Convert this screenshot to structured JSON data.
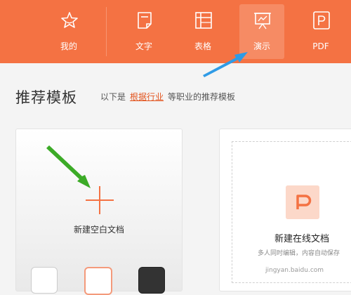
{
  "nav": {
    "items": [
      {
        "label": "我的",
        "icon": "star-icon"
      },
      {
        "label": "文字",
        "icon": "document-icon"
      },
      {
        "label": "表格",
        "icon": "table-icon"
      },
      {
        "label": "演示",
        "icon": "presentation-icon"
      },
      {
        "label": "PDF",
        "icon": "pdf-icon"
      }
    ],
    "active_index": 3
  },
  "section": {
    "title": "推荐模板",
    "subtitle_prefix": "以下是",
    "subtitle_link": "根据行业",
    "subtitle_suffix": "等职业的推荐模板"
  },
  "blank_card": {
    "label": "新建空白文档"
  },
  "online_card": {
    "title": "新建在线文档",
    "description": "多人同时编辑，内容自动保存"
  },
  "watermark": "jingyan.baidu.com",
  "colors": {
    "brand": "#f47243",
    "link": "#e2541e",
    "annotation_blue": "#2f9be6",
    "annotation_green": "#3cab27"
  }
}
